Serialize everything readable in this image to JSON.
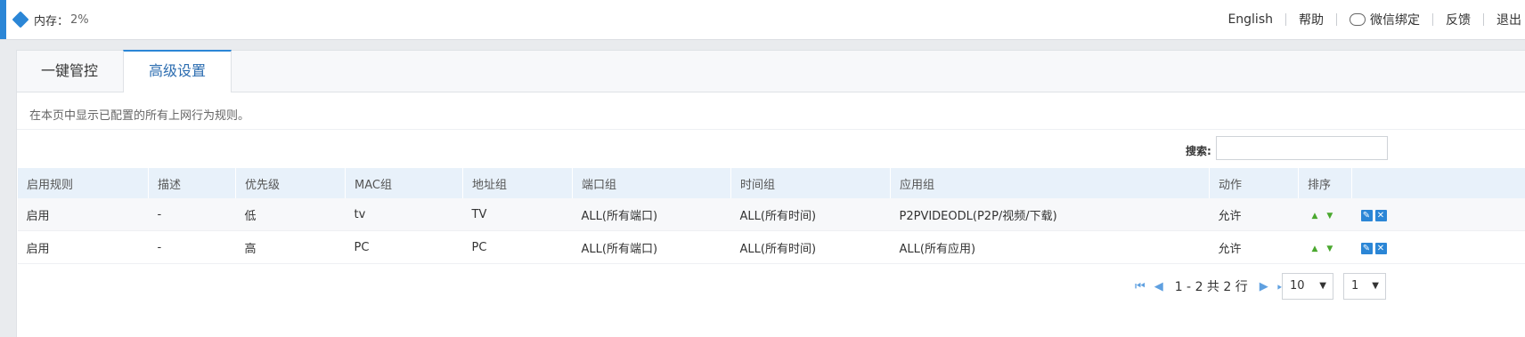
{
  "header": {
    "memory_label": "内存：",
    "memory_value": "2%",
    "nav": [
      "English",
      "帮助",
      "微信绑定",
      "反馈",
      "退出"
    ]
  },
  "tabs": [
    {
      "label": "一键管控",
      "active": false
    },
    {
      "label": "高级设置",
      "active": true
    }
  ],
  "description": "在本页中显示已配置的所有上网行为规则。",
  "search": {
    "label": "搜索:",
    "value": ""
  },
  "table": {
    "columns": [
      "启用规则",
      "描述",
      "优先级",
      "MAC组",
      "地址组",
      "端口组",
      "时间组",
      "应用组",
      "动作",
      "排序",
      ""
    ],
    "rows": [
      [
        "启用",
        "-",
        "低",
        "tv",
        "TV",
        "ALL(所有端口)",
        "ALL(所有时间)",
        "P2PVIDEODL(P2P/视频/下载)",
        "允许"
      ],
      [
        "启用",
        "-",
        "高",
        "PC",
        "PC",
        "ALL(所有端口)",
        "ALL(所有时间)",
        "ALL(所有应用)",
        "允许"
      ]
    ]
  },
  "pagination": {
    "info": "1 - 2 共 2 行",
    "page_size": "10",
    "page": "1"
  },
  "colors": {
    "accent": "#2b86d6",
    "header_row": "#e8f1fa"
  }
}
